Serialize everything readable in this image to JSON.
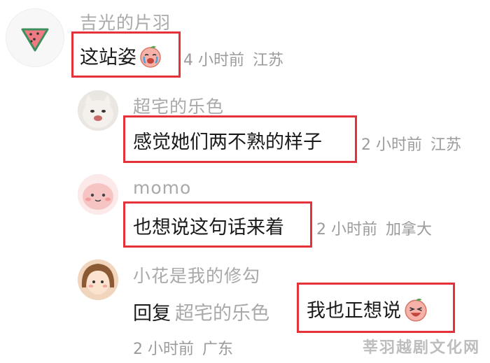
{
  "comments": [
    {
      "username": "吉光的片羽",
      "text": "这站姿",
      "time": "4 小时前",
      "location": "江苏"
    },
    {
      "username": "超宅的乐色",
      "text": "感觉她们两不熟的样子",
      "time": "2 小时前",
      "location": "江苏"
    },
    {
      "username": "momo",
      "text": "也想说这句话来着",
      "time": "2 小时前",
      "location": "加拿大"
    },
    {
      "username": "小花是我的修勾",
      "reply_keyword": "回复",
      "reply_target": "超宅的乐色",
      "text": "我也正想说",
      "time": "2 小时前",
      "location": "广东"
    }
  ],
  "watermark": "莘羽越剧文化网",
  "colors": {
    "highlight": "#e3323a",
    "username": "#a9a9a9",
    "meta": "#9b9b9b"
  },
  "icons": [
    "watermelon-avatar-icon",
    "sad-peach-emoji",
    "laughing-peach-emoji"
  ]
}
